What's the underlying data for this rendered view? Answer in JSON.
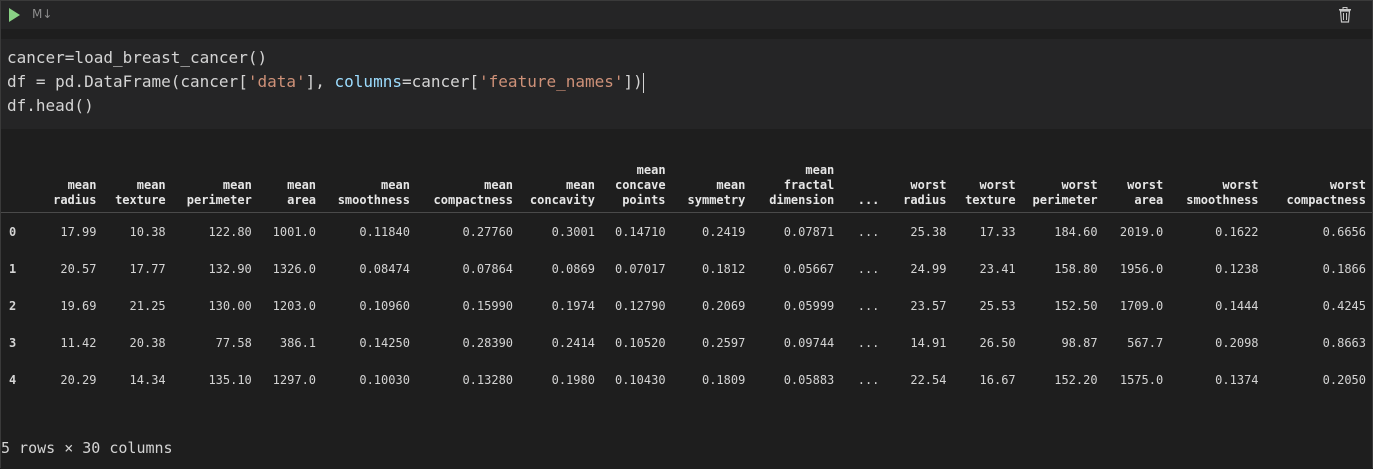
{
  "toolbar": {
    "cell_type": "M↓",
    "run_icon": "play-icon",
    "delete_icon": "trash-icon"
  },
  "code": {
    "line1": "cancer=load_breast_cancer()",
    "line2": {
      "p1": "df = pd.DataFrame(cancer[",
      "s1": "'data'",
      "p2": "], ",
      "kw": "columns",
      "p3": "=cancer[",
      "s2": "'feature_names'",
      "p4": "])"
    },
    "line3": "df.head()"
  },
  "table": {
    "columns": [
      "",
      "mean\nradius",
      "mean\ntexture",
      "mean\nperimeter",
      "mean\narea",
      "mean\nsmoothness",
      "mean\ncompactness",
      "mean\nconcavity",
      "mean\nconcave\npoints",
      "mean\nsymmetry",
      "mean\nfractal\ndimension",
      "...",
      "worst\nradius",
      "worst\ntexture",
      "worst\nperimeter",
      "worst\narea",
      "worst\nsmoothness",
      "worst\ncompactness"
    ],
    "rows": [
      [
        "0",
        "17.99",
        "10.38",
        "122.80",
        "1001.0",
        "0.11840",
        "0.27760",
        "0.3001",
        "0.14710",
        "0.2419",
        "0.07871",
        "...",
        "25.38",
        "17.33",
        "184.60",
        "2019.0",
        "0.1622",
        "0.6656"
      ],
      [
        "1",
        "20.57",
        "17.77",
        "132.90",
        "1326.0",
        "0.08474",
        "0.07864",
        "0.0869",
        "0.07017",
        "0.1812",
        "0.05667",
        "...",
        "24.99",
        "23.41",
        "158.80",
        "1956.0",
        "0.1238",
        "0.1866"
      ],
      [
        "2",
        "19.69",
        "21.25",
        "130.00",
        "1203.0",
        "0.10960",
        "0.15990",
        "0.1974",
        "0.12790",
        "0.2069",
        "0.05999",
        "...",
        "23.57",
        "25.53",
        "152.50",
        "1709.0",
        "0.1444",
        "0.4245"
      ],
      [
        "3",
        "11.42",
        "20.38",
        "77.58",
        "386.1",
        "0.14250",
        "0.28390",
        "0.2414",
        "0.10520",
        "0.2597",
        "0.09744",
        "...",
        "14.91",
        "26.50",
        "98.87",
        "567.7",
        "0.2098",
        "0.8663"
      ],
      [
        "4",
        "20.29",
        "14.34",
        "135.10",
        "1297.0",
        "0.10030",
        "0.13280",
        "0.1980",
        "0.10430",
        "0.1809",
        "0.05883",
        "...",
        "22.54",
        "16.67",
        "152.20",
        "1575.0",
        "0.1374",
        "0.2050"
      ]
    ]
  },
  "footer": "5 rows × 30 columns",
  "colors": {
    "background": "#1e1e1e",
    "code_background": "#252526",
    "run": "#89d185",
    "string": "#ce9178",
    "keyword_arg": "#9cdcfe"
  }
}
